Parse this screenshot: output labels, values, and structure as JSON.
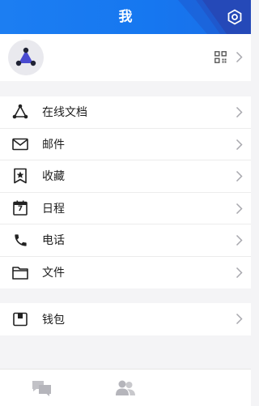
{
  "header": {
    "title": "我"
  },
  "profile": {
    "name": ""
  },
  "menu_primary": [
    {
      "label": "在线文档",
      "icon": "online-docs-icon"
    },
    {
      "label": "邮件",
      "icon": "mail-icon"
    },
    {
      "label": "收藏",
      "icon": "bookmark-icon"
    },
    {
      "label": "日程",
      "icon": "calendar-icon"
    },
    {
      "label": "电话",
      "icon": "phone-icon"
    },
    {
      "label": "文件",
      "icon": "folder-icon"
    }
  ],
  "menu_secondary": [
    {
      "label": "钱包",
      "icon": "wallet-icon"
    }
  ],
  "calendar_day": "7",
  "colors": {
    "header_blue": "#1677f0",
    "header_accent": "#2549b8",
    "background": "#f4f4f6",
    "icon_gray": "#bfbfc4"
  }
}
